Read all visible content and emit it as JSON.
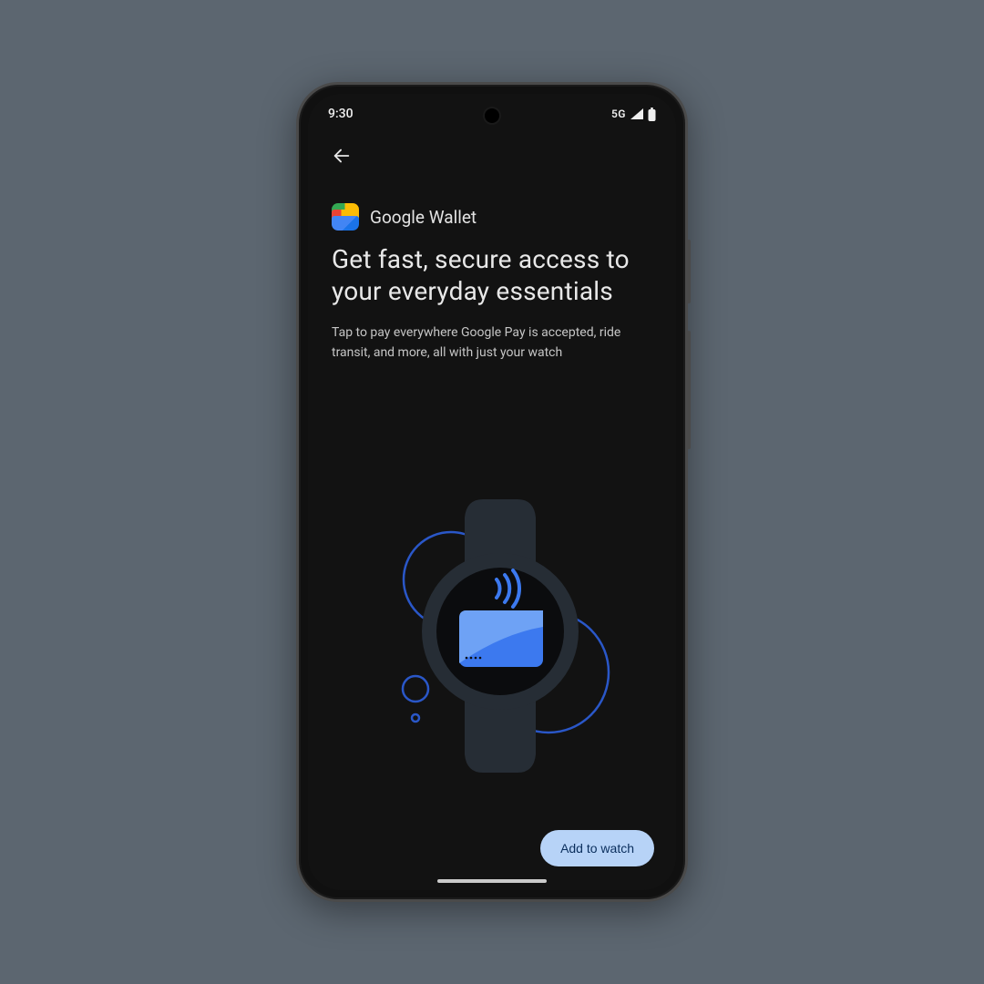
{
  "statusbar": {
    "time": "9:30",
    "network_label": "5G"
  },
  "app": {
    "name": "Google Wallet"
  },
  "headline": "Get fast, secure access to your everyday essentials",
  "subtext": "Tap to pay everywhere Google Pay is accepted, ride transit, and more, all with just your watch",
  "cta": {
    "label": "Add to watch"
  },
  "colors": {
    "accent_button_bg": "#b7d3f7",
    "accent_button_fg": "#0a2e5c",
    "illustration_blue": "#2a6af0"
  }
}
